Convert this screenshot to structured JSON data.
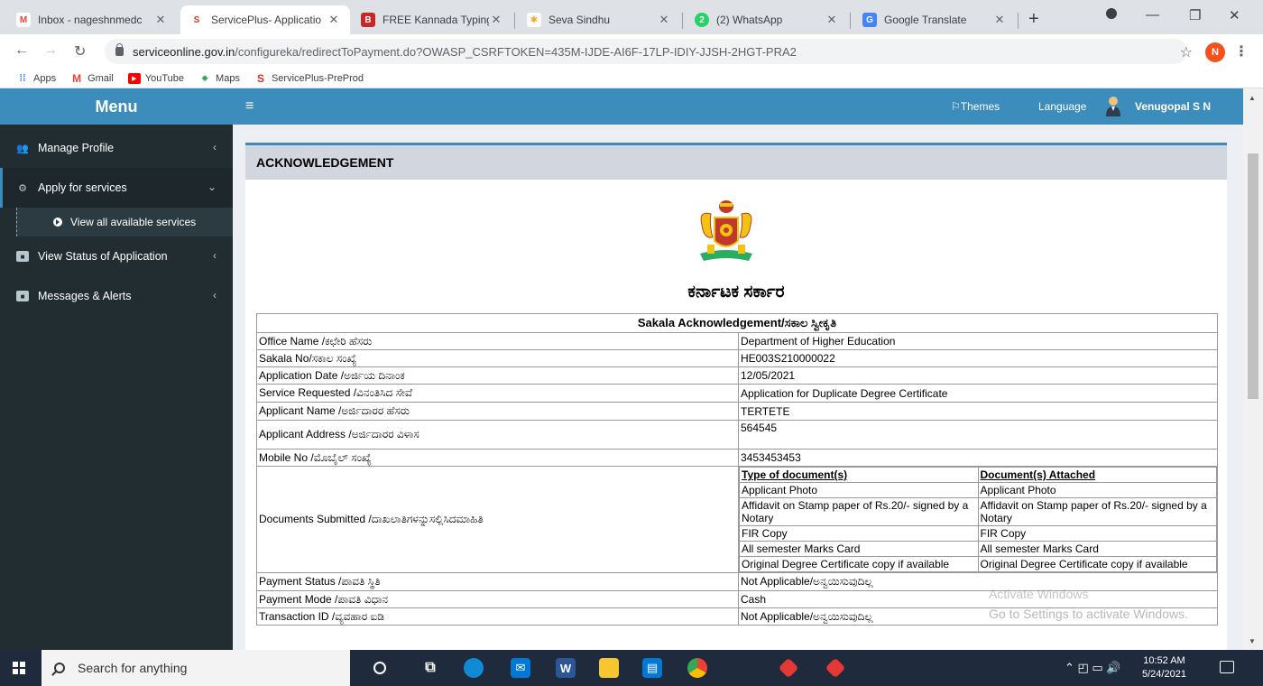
{
  "browser": {
    "tabs": [
      {
        "label": "Inbox - nageshnmedc",
        "icon": "gmail-icon",
        "color": "#ea4335",
        "glyph": "M"
      },
      {
        "label": "ServicePlus- Applicatio",
        "icon": "serviceplus-icon",
        "color": "#d93025",
        "glyph": "S"
      },
      {
        "label": "FREE Kannada Typing |",
        "icon": "typing-icon",
        "color": "#c62828",
        "glyph": "B"
      },
      {
        "label": "Seva Sindhu",
        "icon": "seva-sindhu-icon",
        "color": "#fbbc04",
        "glyph": "✱"
      },
      {
        "label": "(2) WhatsApp",
        "icon": "whatsapp-icon",
        "color": "#25d366",
        "glyph": "2"
      },
      {
        "label": "Google Translate",
        "icon": "translate-icon",
        "color": "#4285f4",
        "glyph": "G"
      }
    ],
    "url_host": "serviceonline.gov.in",
    "url_path": "/configureka/redirectToPayment.do?OWASP_CSRFTOKEN=435M-IJDE-AI6F-17LP-IDIY-JJSH-2HGT-PRA2",
    "profile_initial": "N",
    "bookmarks": [
      {
        "label": "Apps",
        "color": "#4285f4",
        "glyph": "⋮⋮"
      },
      {
        "label": "Gmail",
        "color": "#ea4335",
        "glyph": "M"
      },
      {
        "label": "YouTube",
        "color": "#ff0000",
        "glyph": "▶"
      },
      {
        "label": "Maps",
        "color": "#34a853",
        "glyph": "◆"
      },
      {
        "label": "ServicePlus-PreProd",
        "color": "#d93025",
        "glyph": "S"
      }
    ]
  },
  "sidebar": {
    "title": "Menu",
    "items": [
      {
        "label": "Manage Profile",
        "icon": "users-icon"
      },
      {
        "label": "Apply for services",
        "icon": "cogs-icon"
      },
      {
        "label": "View Status of Application",
        "icon": "status-icon"
      },
      {
        "label": "Messages & Alerts",
        "icon": "message-icon"
      }
    ],
    "submenu": {
      "label": "View all available services"
    }
  },
  "topnav": {
    "themes": "Themes",
    "language": "Language",
    "user": "Venugopal S N"
  },
  "ack": {
    "heading": "ACKNOWLEDGEMENT",
    "gov_title": "ಕರ್ನಾಟಕ ಸರ್ಕಾರ",
    "table_title": "Sakala Acknowledgement/ಸಕಾಲ ಸ್ವೀಕೃತಿ",
    "rows": [
      {
        "label": "Office Name /ಕಛೇರಿ ಹೆಸರು",
        "value": "Department of Higher Education"
      },
      {
        "label": "Sakala No/ಸಕಾಲ ಸಂಖ್ಯೆ",
        "value": "HE003S210000022"
      },
      {
        "label": "Application Date /ಅರ್ಜಿಯ ದಿನಾಂಕ",
        "value": "12/05/2021"
      },
      {
        "label": "Service Requested /ವಿನಂತಿಸಿದ ಸೇವೆ",
        "value": "Application for Duplicate Degree Certificate"
      },
      {
        "label": "Applicant Name /ಅರ್ಜಿದಾರರ ಹೆಸರು",
        "value": "TERTETE"
      },
      {
        "label": "Applicant Address /ಅರ್ಜಿದಾರರ ವಿಳಾಸ",
        "value": "564545"
      },
      {
        "label": "Mobile No /ಮೊಬೈಲ್ ಸಂಖ್ಯೆ",
        "value": "3453453453"
      }
    ],
    "docs_label": "Documents Submitted /ದಾಖಲಾತಿಗಳನ್ನುಸಲ್ಲಿಸಿದಮಾಹಿತಿ",
    "docs_headers": [
      "Type of document(s)",
      "Document(s) Attached"
    ],
    "docs": [
      [
        "Applicant Photo",
        "Applicant Photo"
      ],
      [
        "Affidavit on Stamp paper of Rs.20/- signed by a Notary",
        "Affidavit on Stamp paper of Rs.20/- signed by a Notary"
      ],
      [
        "FIR Copy",
        "FIR Copy"
      ],
      [
        "All semester Marks Card",
        "All semester Marks Card"
      ],
      [
        "Original Degree Certificate copy if available",
        "Original Degree Certificate copy if available"
      ]
    ],
    "rows_after": [
      {
        "label": "Payment Status /ಪಾವತಿ ಸ್ಥಿತಿ",
        "value": "Not Applicable/ಅನ್ವಯಿಸುವುದಿಲ್ಲ"
      },
      {
        "label": "Payment Mode /ಪಾವತಿ ವಿಧಾನ",
        "value": "Cash"
      },
      {
        "label": "Transaction ID /ವ್ಯವಹಾರ ಐಡಿ",
        "value": "Not Applicable/ಅನ್ವಯಿಸುವುದಿಲ್ಲ"
      }
    ]
  },
  "watermark": {
    "line1": "Activate Windows",
    "line2": "Go to Settings to activate Windows."
  },
  "taskbar": {
    "search_placeholder": "Search for anything",
    "time": "10:52 AM",
    "date": "5/24/2021"
  }
}
